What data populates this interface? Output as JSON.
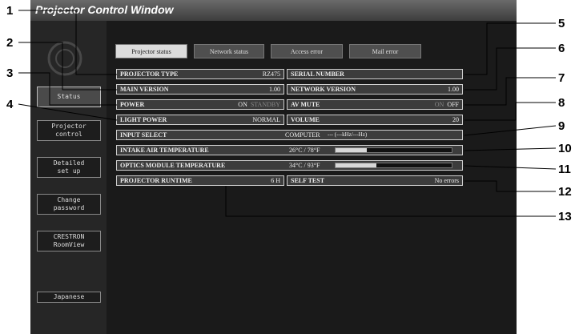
{
  "window": {
    "title": "Projector Control Window"
  },
  "sidebar": {
    "items": [
      {
        "label": "Status"
      },
      {
        "label": "Projector\ncontrol"
      },
      {
        "label": "Detailed\nset up"
      },
      {
        "label": "Change\npassword"
      },
      {
        "label": "CRESTRON\nRoomView"
      },
      {
        "label": "Japanese"
      }
    ]
  },
  "tabs": [
    {
      "label": "Projector status"
    },
    {
      "label": "Network status"
    },
    {
      "label": "Access error"
    },
    {
      "label": "Mail error"
    }
  ],
  "status": {
    "projector_type": {
      "label": "PROJECTOR TYPE",
      "value": "RZ475"
    },
    "serial_number": {
      "label": "SERIAL NUMBER",
      "value": ""
    },
    "main_version": {
      "label": "MAIN VERSION",
      "value": "1.00"
    },
    "network_version": {
      "label": "NETWORK VERSION",
      "value": "1.00"
    },
    "power": {
      "label": "POWER",
      "on": "ON",
      "standby": "STANDBY"
    },
    "av_mute": {
      "label": "AV MUTE",
      "on": "ON",
      "off": "OFF"
    },
    "light_power": {
      "label": "LIGHT POWER",
      "value": "NORMAL"
    },
    "volume": {
      "label": "VOLUME",
      "value": "20"
    },
    "input_select": {
      "label": "INPUT SELECT",
      "value": "COMPUTER",
      "freq": "--- (---kHz/---Hz)"
    },
    "intake_air_temp": {
      "label": "INTAKE AIR TEMPERATURE",
      "value": "26°C / 78°F",
      "level": 0.27
    },
    "optics_module_temp": {
      "label": "OPTICS MODULE TEMPERATURE",
      "value": "34°C / 93°F",
      "level": 0.35
    },
    "projector_runtime": {
      "label": "PROJECTOR RUNTIME",
      "value": "6 H"
    },
    "self_test": {
      "label": "SELF TEST",
      "value": "No errors"
    }
  },
  "callouts": [
    "1",
    "2",
    "3",
    "4",
    "5",
    "6",
    "7",
    "8",
    "9",
    "10",
    "11",
    "12",
    "13"
  ]
}
